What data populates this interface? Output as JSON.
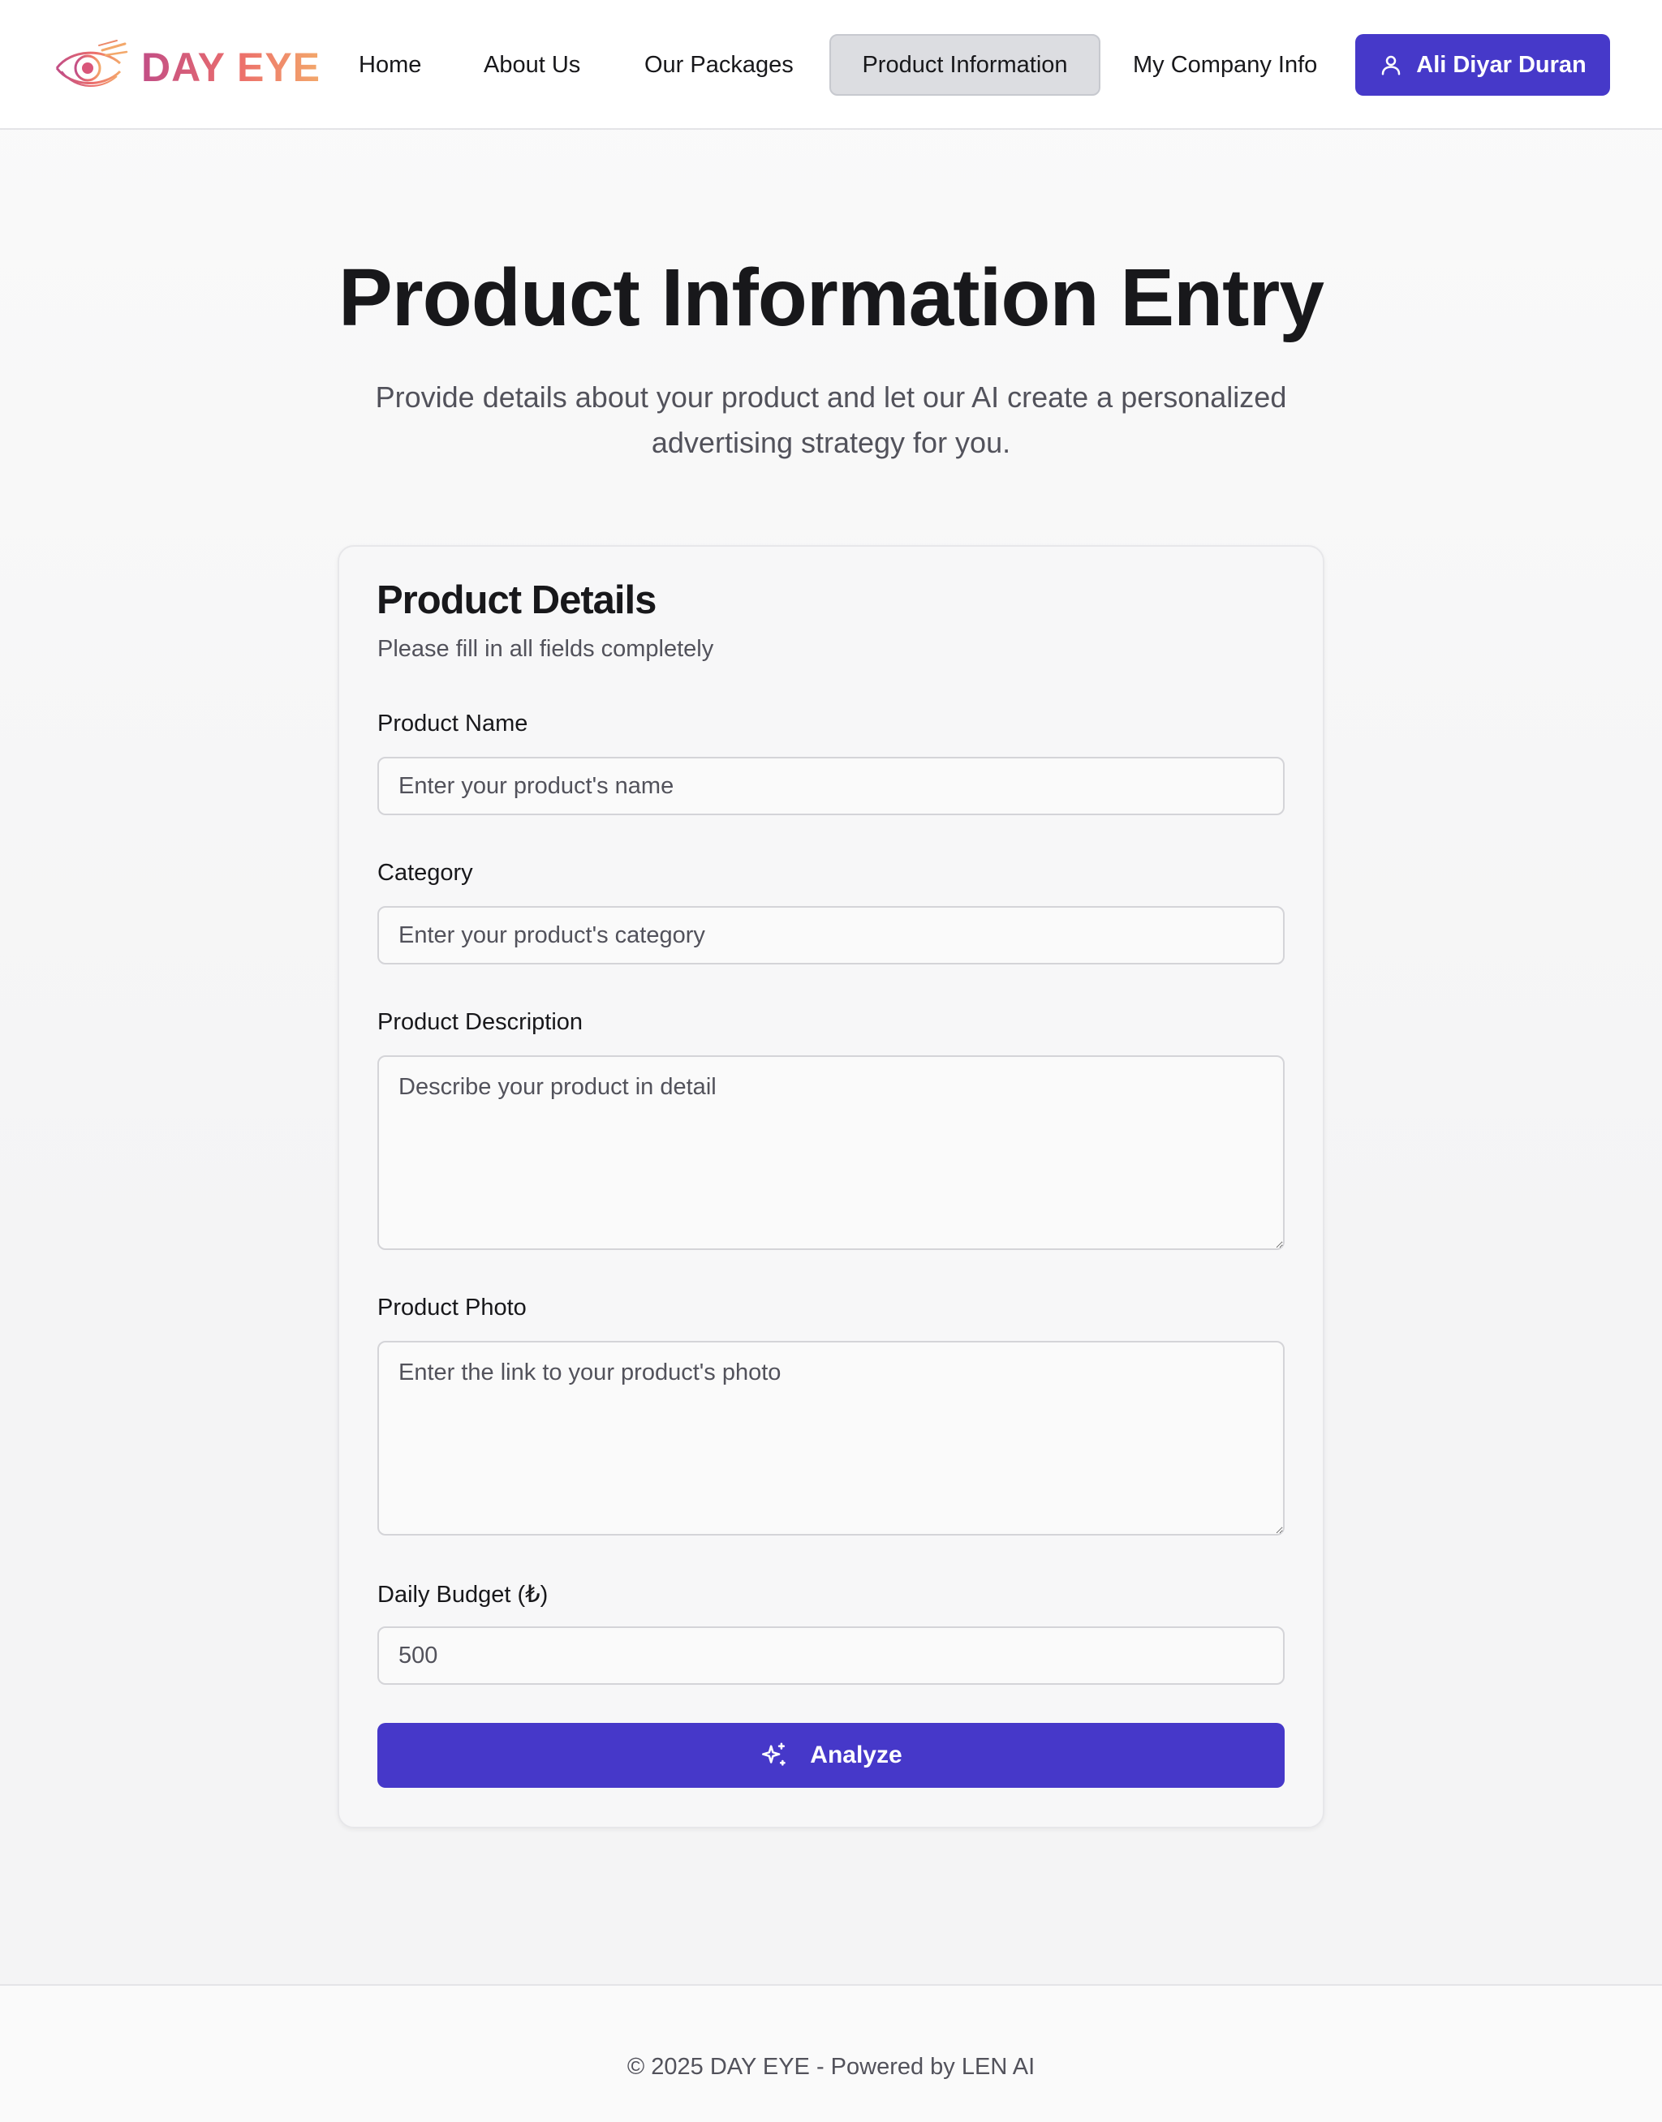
{
  "header": {
    "logo_text": "DAY EYE",
    "logo_icon": "eye-logo-icon",
    "nav": [
      {
        "label": "Home"
      },
      {
        "label": "About Us"
      },
      {
        "label": "Our Packages"
      },
      {
        "label": "Product Information",
        "active": true
      },
      {
        "label": "My Company Info"
      }
    ],
    "user": {
      "name": "Ali Diyar Duran",
      "icon": "user-icon"
    }
  },
  "hero": {
    "title": "Product Information Entry",
    "subtitle": "Provide details about your product and let our AI create a personalized advertising strategy for you."
  },
  "form": {
    "title": "Product Details",
    "description": "Please fill in all fields completely",
    "product_name": {
      "label": "Product Name",
      "placeholder": "Enter your product's name",
      "value": ""
    },
    "category": {
      "label": "Category",
      "placeholder": "Enter your product's category",
      "value": ""
    },
    "description_field": {
      "label": "Product Description",
      "placeholder": "Describe your product in detail",
      "value": ""
    },
    "photo": {
      "label": "Product Photo",
      "placeholder": "Enter the link to your product's photo",
      "value": ""
    },
    "budget": {
      "label": "Daily Budget (₺)",
      "placeholder": "500",
      "value": ""
    },
    "submit": {
      "label": "Analyze",
      "icon": "sparkles-icon"
    }
  },
  "footer": {
    "text": "© 2025 DAY EYE - Powered by LEN AI"
  },
  "colors": {
    "accent": "#4639c9",
    "logo_gradient_start": "#c24e86",
    "logo_gradient_end": "#f3a86b",
    "active_nav_bg": "#dcdde1"
  }
}
